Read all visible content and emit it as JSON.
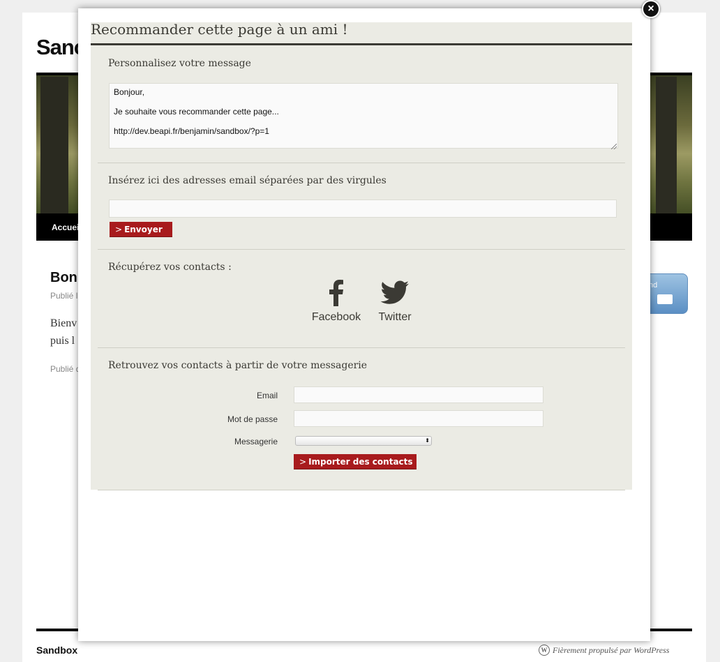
{
  "background": {
    "site_title": "Sanc",
    "nav_item": "Accuei",
    "post_title": "Bon",
    "post_meta": "Publié l",
    "post_body_line1": "Bienv",
    "post_body_line2": "puis l",
    "post_meta2": "Publié d",
    "send_widget_label": "nd",
    "footer_left": "Sandbox",
    "footer_right": "Fièrement propulsé par WordPress"
  },
  "modal": {
    "title": "Recommander cette page à un ami !",
    "close_label": "×",
    "sections": {
      "message": {
        "title": "Personnalisez votre message",
        "lines": [
          "Bonjour,",
          "Je souhaite vous recommander cette page...",
          "http://dev.beapi.fr/benjamin/sandbox/?p=1"
        ]
      },
      "emails": {
        "title": "Insérez ici des adresses email séparées par des virgules",
        "input_value": "",
        "send_button": "Envoyer"
      },
      "contacts": {
        "title": "Récupérez vos contacts :",
        "facebook_label": "Facebook",
        "twitter_label": "Twitter"
      },
      "mail_import": {
        "title": "Retrouvez vos contacts à partir de votre messagerie",
        "email_label": "Email",
        "password_label": "Mot de passe",
        "provider_label": "Messagerie",
        "provider_value": "",
        "import_button": "Importer des contacts"
      }
    }
  },
  "colors": {
    "accent_red": "#a81b1d",
    "panel_bg": "#ebebe4",
    "text_dark": "#3b3a34"
  },
  "icons": [
    "close-icon",
    "facebook-icon",
    "twitter-icon",
    "wordpress-icon",
    "envelope-icon"
  ]
}
